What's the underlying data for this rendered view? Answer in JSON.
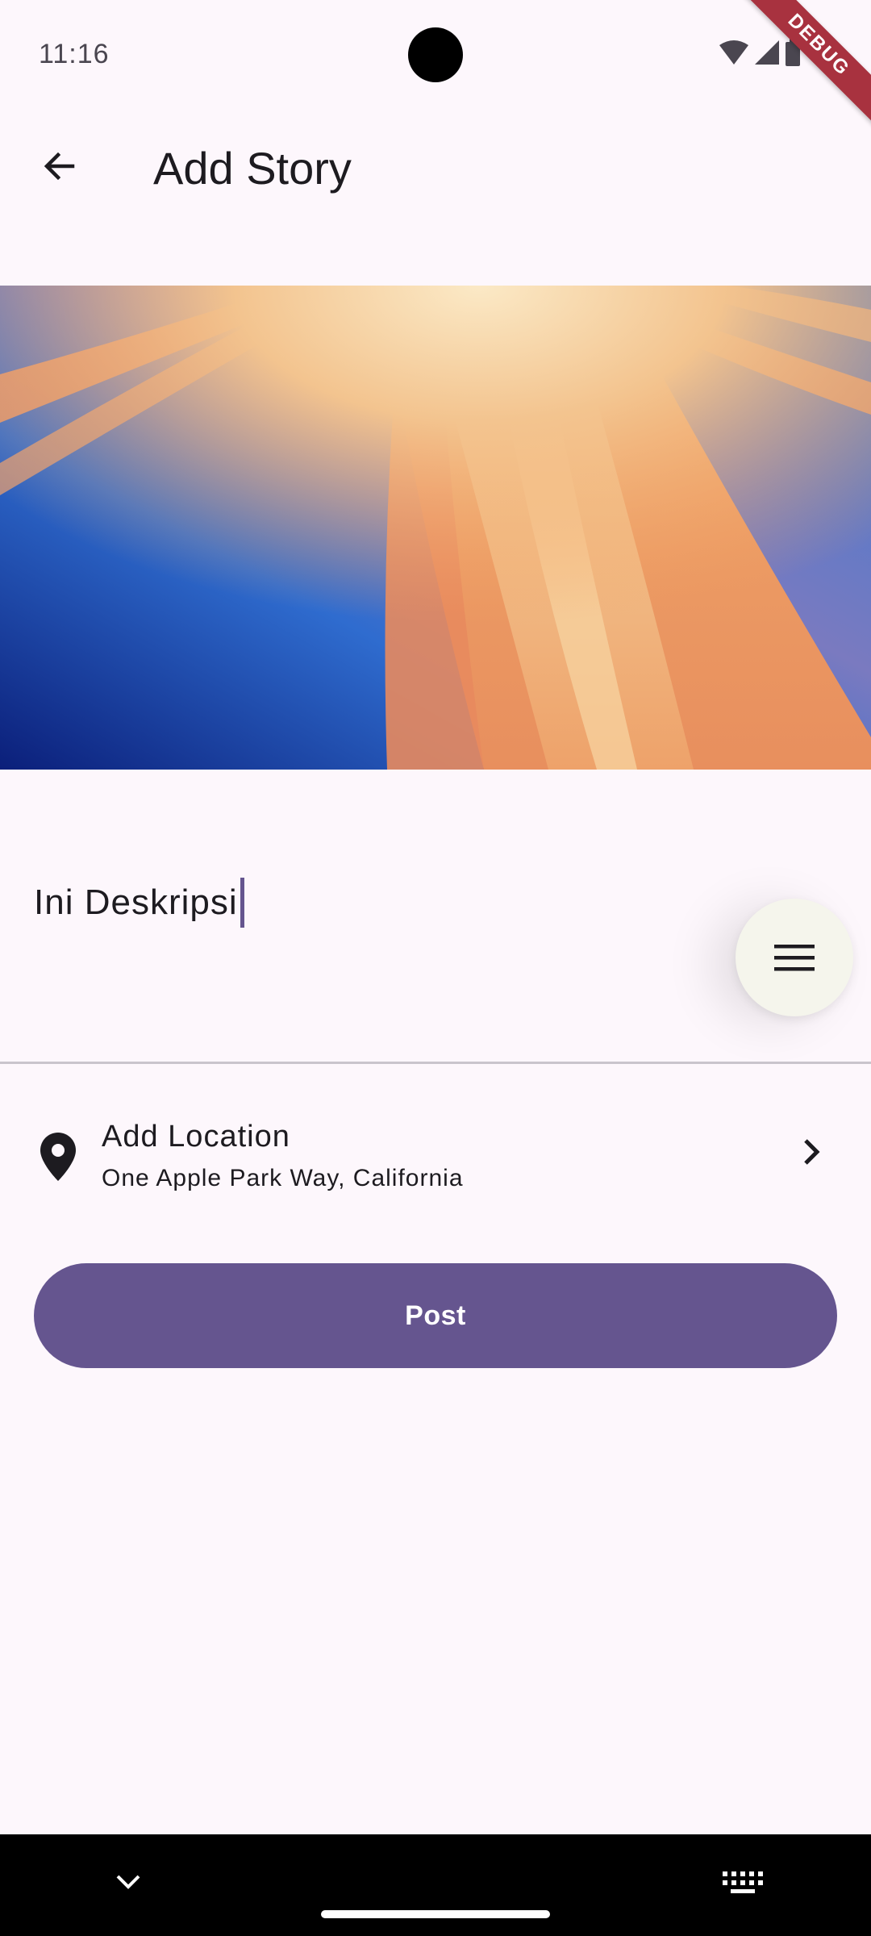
{
  "status_bar": {
    "time": "11:16",
    "debug_label": "DEBUG",
    "icons": [
      "wifi-icon",
      "signal-icon",
      "battery-icon"
    ]
  },
  "app_bar": {
    "title": "Add Story",
    "back_icon": "arrow-back-icon"
  },
  "hero_image": {
    "description_icon": "story-image"
  },
  "description": {
    "value": "Ini Deskripsi"
  },
  "fab": {
    "icon": "menu-icon"
  },
  "location": {
    "title": "Add Location",
    "subtitle": "One Apple Park Way, California",
    "icon": "location-pin-icon",
    "chevron_icon": "chevron-right-icon"
  },
  "post_button": {
    "label": "Post"
  },
  "navigation_bar": {
    "icons": [
      "chevron-down-icon",
      "keyboard-icon"
    ]
  },
  "colors": {
    "background": "#fdf7fc",
    "primary": "#65558f",
    "fab_background": "#f5f5ec",
    "debug_ribbon": "#a8323f"
  }
}
